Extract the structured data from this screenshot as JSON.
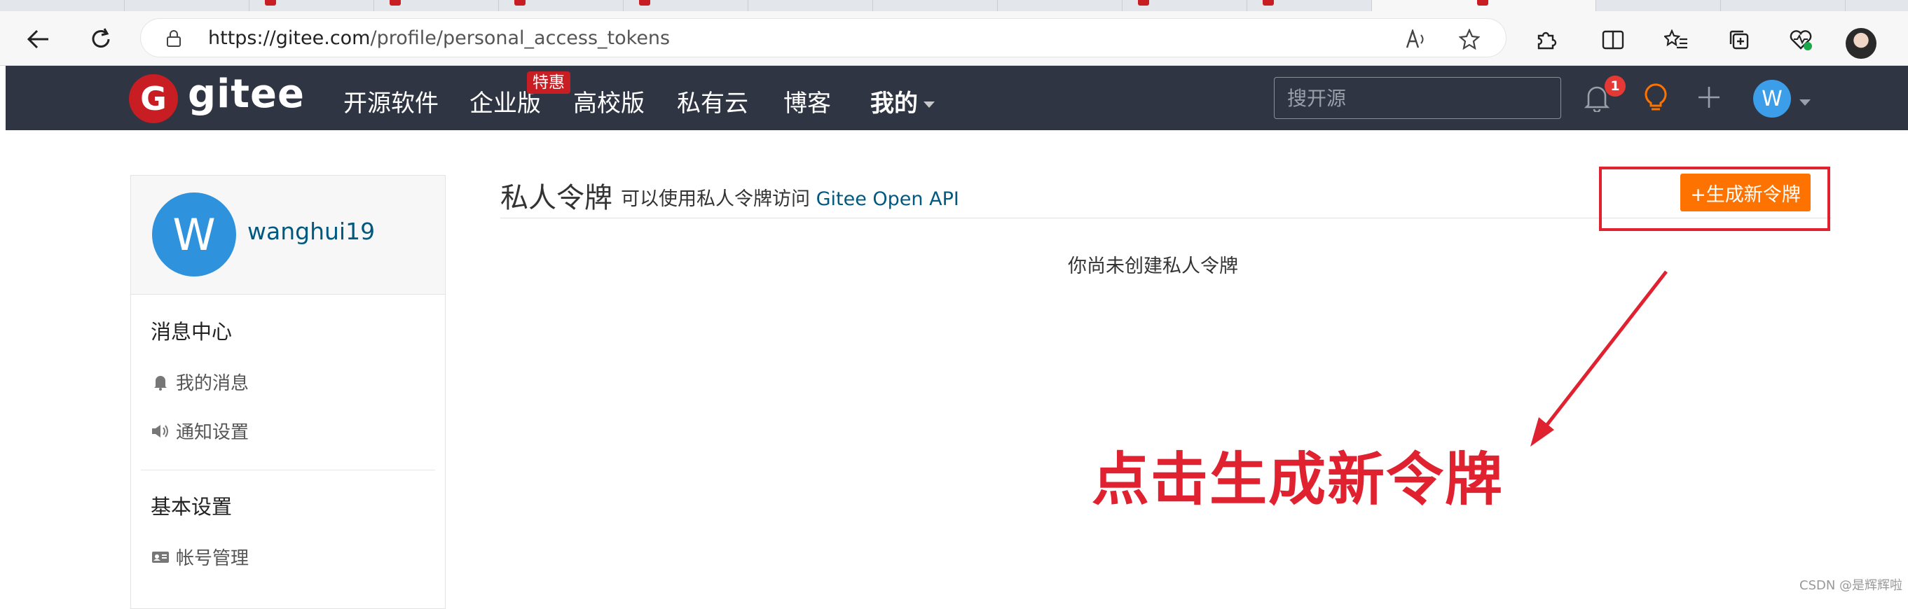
{
  "browser": {
    "url_host": "https://gitee.com",
    "url_path": "/profile/personal_access_tokens"
  },
  "header": {
    "logo_letter": "G",
    "logo_text": "gitee",
    "nav": [
      "开源软件",
      "企业版",
      "高校版",
      "私有云",
      "博客",
      "我的"
    ],
    "promo_badge": "特惠",
    "search_placeholder": "搜开源",
    "notification_count": "1",
    "user_initial": "W"
  },
  "sidebar": {
    "avatar_initial": "W",
    "username": "wanghui19",
    "section_messages": "消息中心",
    "item_my_messages": "我的消息",
    "item_notify_settings": "通知设置",
    "section_basic": "基本设置",
    "item_account": "帐号管理"
  },
  "main": {
    "title": "私人令牌",
    "subtitle_prefix": "可以使用私人令牌访问",
    "subtitle_link": "Gitee Open API",
    "new_token_button": "+生成新令牌",
    "empty_message": "你尚未创建私人令牌"
  },
  "annotation": {
    "text": "点击生成新令牌",
    "color": "#e0212f"
  },
  "watermark": "CSDN @是辉辉啦",
  "colors": {
    "header_bg": "#2f3542",
    "brand_red": "#c71d23",
    "accent_orange": "#fe7300",
    "link": "#005980"
  }
}
